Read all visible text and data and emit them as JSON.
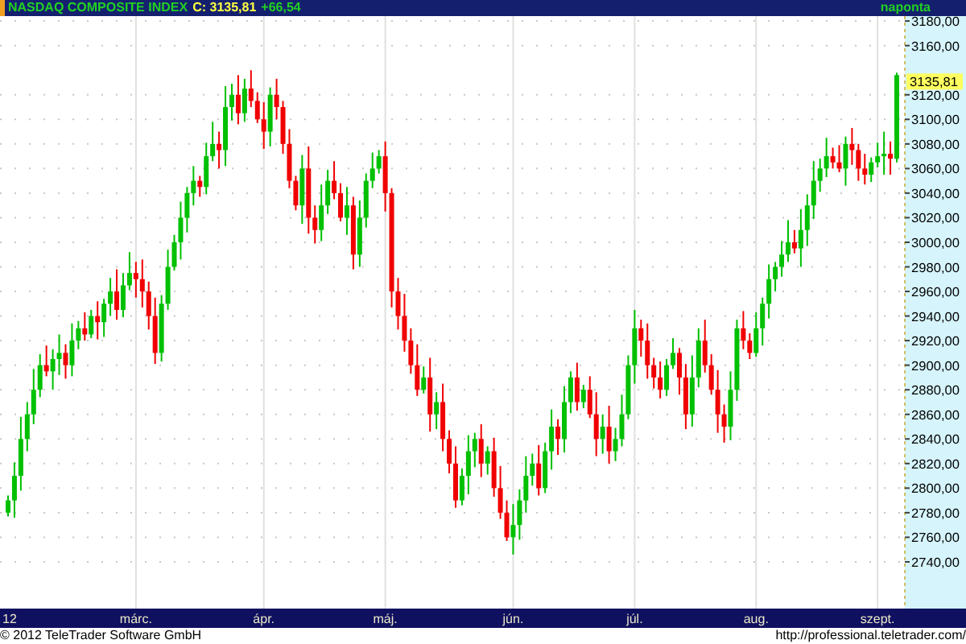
{
  "header": {
    "title": "NASDAQ COMPOSITE INDEX",
    "close": "C: 3135,81",
    "change": "+66,54",
    "interval": "naponta"
  },
  "chart": {
    "price_tag": "3135,81",
    "chart_data": {
      "type": "candlestick",
      "grid": true,
      "ylim": [
        2702,
        3184
      ],
      "categories": [
        "12",
        null,
        null,
        null,
        null,
        null,
        null,
        null,
        null,
        null,
        null,
        null,
        null,
        null,
        null,
        null,
        null,
        null,
        null,
        null,
        "márc.",
        null,
        null,
        null,
        null,
        null,
        null,
        null,
        null,
        null,
        null,
        null,
        null,
        null,
        null,
        null,
        null,
        null,
        null,
        null,
        "ápr.",
        null,
        null,
        null,
        null,
        null,
        null,
        null,
        null,
        null,
        null,
        null,
        null,
        null,
        null,
        null,
        null,
        null,
        null,
        "máj.",
        null,
        null,
        null,
        null,
        null,
        null,
        null,
        null,
        null,
        null,
        null,
        null,
        null,
        null,
        null,
        null,
        null,
        null,
        null,
        "jún.",
        null,
        null,
        null,
        null,
        null,
        null,
        null,
        null,
        null,
        null,
        null,
        null,
        null,
        null,
        null,
        null,
        null,
        null,
        "júl.",
        null,
        null,
        null,
        null,
        null,
        null,
        null,
        null,
        null,
        null,
        null,
        null,
        null,
        null,
        null,
        null,
        null,
        null,
        "aug.",
        null,
        null,
        null,
        null,
        null,
        null,
        null,
        null,
        null,
        null,
        null,
        null,
        null,
        null,
        null,
        null,
        null,
        null,
        "szept.",
        null,
        null,
        null
      ],
      "yticks": [
        {
          "value": 3180,
          "label": "3180,00"
        },
        {
          "value": 3160,
          "label": "3160,00"
        },
        {
          "value": 3120,
          "label": "3120,00"
        },
        {
          "value": 3100,
          "label": "3100,00"
        },
        {
          "value": 3080,
          "label": "3080,00"
        },
        {
          "value": 3060,
          "label": "3060,00"
        },
        {
          "value": 3040,
          "label": "3040,00"
        },
        {
          "value": 3020,
          "label": "3020,00"
        },
        {
          "value": 3000,
          "label": "3000,00"
        },
        {
          "value": 2980,
          "label": "2980,00"
        },
        {
          "value": 2960,
          "label": "2960,00"
        },
        {
          "value": 2940,
          "label": "2940,00"
        },
        {
          "value": 2920,
          "label": "2920,00"
        },
        {
          "value": 2900,
          "label": "2900,00"
        },
        {
          "value": 2880,
          "label": "2880,00"
        },
        {
          "value": 2860,
          "label": "2860,00"
        },
        {
          "value": 2840,
          "label": "2840,00"
        },
        {
          "value": 2820,
          "label": "2820,00"
        },
        {
          "value": 2800,
          "label": "2800,00"
        },
        {
          "value": 2780,
          "label": "2780,00"
        },
        {
          "value": 2760,
          "label": "2760,00"
        },
        {
          "value": 2740,
          "label": "2740,00"
        }
      ],
      "ohlc": [
        [
          2780,
          2794,
          2777,
          2790
        ],
        [
          2790,
          2821,
          2776,
          2810
        ],
        [
          2810,
          2858,
          2798,
          2840
        ],
        [
          2840,
          2870,
          2830,
          2860
        ],
        [
          2860,
          2897,
          2852,
          2880
        ],
        [
          2880,
          2909,
          2874,
          2900
        ],
        [
          2900,
          2916,
          2891,
          2895
        ],
        [
          2895,
          2913,
          2880,
          2905
        ],
        [
          2905,
          2925,
          2892,
          2910
        ],
        [
          2910,
          2917,
          2889,
          2900
        ],
        [
          2900,
          2934,
          2891,
          2920
        ],
        [
          2920,
          2936,
          2913,
          2930
        ],
        [
          2930,
          2943,
          2920,
          2925
        ],
        [
          2925,
          2945,
          2922,
          2940
        ],
        [
          2940,
          2952,
          2921,
          2935
        ],
        [
          2935,
          2954,
          2923,
          2950
        ],
        [
          2950,
          2971,
          2940,
          2960
        ],
        [
          2960,
          2978,
          2937,
          2945
        ],
        [
          2945,
          2975,
          2939,
          2965
        ],
        [
          2965,
          2992,
          2961,
          2975
        ],
        [
          2975,
          2984,
          2955,
          2970
        ],
        [
          2970,
          2986,
          2947,
          2960
        ],
        [
          2960,
          2968,
          2929,
          2940
        ],
        [
          2940,
          2955,
          2901,
          2910
        ],
        [
          2910,
          2957,
          2903,
          2950
        ],
        [
          2950,
          2994,
          2945,
          2980
        ],
        [
          2980,
          3006,
          2977,
          3000
        ],
        [
          3000,
          3033,
          2986,
          3020
        ],
        [
          3020,
          3045,
          3008,
          3040
        ],
        [
          3040,
          3062,
          3030,
          3050
        ],
        [
          3050,
          3054,
          3037,
          3045
        ],
        [
          3045,
          3081,
          3039,
          3070
        ],
        [
          3070,
          3098,
          3066,
          3080
        ],
        [
          3080,
          3090,
          3060,
          3075
        ],
        [
          3075,
          3127,
          3062,
          3110
        ],
        [
          3110,
          3129,
          3099,
          3120
        ],
        [
          3120,
          3136,
          3096,
          3105
        ],
        [
          3105,
          3133,
          3098,
          3125
        ],
        [
          3125,
          3140,
          3110,
          3115
        ],
        [
          3115,
          3122,
          3097,
          3100
        ],
        [
          3100,
          3114,
          3076,
          3090
        ],
        [
          3090,
          3126,
          3078,
          3120
        ],
        [
          3120,
          3133,
          3100,
          3110
        ],
        [
          3110,
          3115,
          3072,
          3080
        ],
        [
          3080,
          3092,
          3044,
          3050
        ],
        [
          3050,
          3054,
          3026,
          3030
        ],
        [
          3030,
          3071,
          3015,
          3060
        ],
        [
          3060,
          3078,
          3007,
          3020
        ],
        [
          3020,
          3030,
          2999,
          3010
        ],
        [
          3010,
          3047,
          3001,
          3030
        ],
        [
          3030,
          3059,
          3023,
          3050
        ],
        [
          3050,
          3066,
          3035,
          3040
        ],
        [
          3040,
          3048,
          3017,
          3020
        ],
        [
          3020,
          3045,
          3006,
          3030
        ],
        [
          3030,
          3037,
          2978,
          2990
        ],
        [
          2990,
          3034,
          2980,
          3020
        ],
        [
          3020,
          3056,
          3012,
          3050
        ],
        [
          3050,
          3073,
          3044,
          3060
        ],
        [
          3060,
          3075,
          3056,
          3070
        ],
        [
          3070,
          3082,
          3025,
          3040
        ],
        [
          3040,
          3044,
          2947,
          2960
        ],
        [
          2960,
          2971,
          2929,
          2940
        ],
        [
          2940,
          2958,
          2911,
          2920
        ],
        [
          2920,
          2930,
          2893,
          2900
        ],
        [
          2900,
          2917,
          2875,
          2880
        ],
        [
          2880,
          2899,
          2877,
          2890
        ],
        [
          2890,
          2906,
          2846,
          2860
        ],
        [
          2860,
          2878,
          2848,
          2870
        ],
        [
          2870,
          2885,
          2830,
          2840
        ],
        [
          2840,
          2847,
          2812,
          2820
        ],
        [
          2820,
          2834,
          2784,
          2790
        ],
        [
          2790,
          2816,
          2786,
          2810
        ],
        [
          2810,
          2843,
          2795,
          2830
        ],
        [
          2830,
          2845,
          2817,
          2840
        ],
        [
          2840,
          2852,
          2809,
          2820
        ],
        [
          2820,
          2834,
          2811,
          2830
        ],
        [
          2830,
          2841,
          2793,
          2800
        ],
        [
          2800,
          2818,
          2775,
          2780
        ],
        [
          2780,
          2790,
          2757,
          2760
        ],
        [
          2760,
          2787,
          2746,
          2770
        ],
        [
          2770,
          2799,
          2758,
          2790
        ],
        [
          2790,
          2826,
          2780,
          2810
        ],
        [
          2810,
          2828,
          2802,
          2820
        ],
        [
          2820,
          2835,
          2794,
          2800
        ],
        [
          2800,
          2837,
          2796,
          2830
        ],
        [
          2830,
          2864,
          2815,
          2850
        ],
        [
          2850,
          2856,
          2827,
          2840
        ],
        [
          2840,
          2883,
          2829,
          2870
        ],
        [
          2870,
          2895,
          2861,
          2890
        ],
        [
          2890,
          2902,
          2863,
          2870
        ],
        [
          2870,
          2884,
          2865,
          2880
        ],
        [
          2880,
          2891,
          2857,
          2860
        ],
        [
          2860,
          2878,
          2826,
          2840
        ],
        [
          2840,
          2860,
          2828,
          2850
        ],
        [
          2850,
          2867,
          2820,
          2830
        ],
        [
          2830,
          2849,
          2822,
          2840
        ],
        [
          2840,
          2876,
          2834,
          2860
        ],
        [
          2860,
          2908,
          2856,
          2900
        ],
        [
          2900,
          2945,
          2885,
          2930
        ],
        [
          2930,
          2937,
          2907,
          2920
        ],
        [
          2920,
          2934,
          2889,
          2900
        ],
        [
          2900,
          2906,
          2881,
          2890
        ],
        [
          2890,
          2903,
          2873,
          2880
        ],
        [
          2880,
          2905,
          2875,
          2900
        ],
        [
          2900,
          2922,
          2897,
          2910
        ],
        [
          2910,
          2914,
          2876,
          2890
        ],
        [
          2890,
          2901,
          2848,
          2860
        ],
        [
          2860,
          2908,
          2850,
          2890
        ],
        [
          2890,
          2930,
          2882,
          2920
        ],
        [
          2920,
          2937,
          2894,
          2900
        ],
        [
          2900,
          2909,
          2876,
          2880
        ],
        [
          2880,
          2896,
          2845,
          2860
        ],
        [
          2860,
          2868,
          2837,
          2850
        ],
        [
          2850,
          2895,
          2839,
          2880
        ],
        [
          2880,
          2937,
          2871,
          2930
        ],
        [
          2930,
          2944,
          2913,
          2920
        ],
        [
          2920,
          2926,
          2905,
          2910
        ],
        [
          2910,
          2943,
          2907,
          2930
        ],
        [
          2930,
          2955,
          2916,
          2950
        ],
        [
          2950,
          2982,
          2938,
          2970
        ],
        [
          2970,
          2984,
          2960,
          2980
        ],
        [
          2980,
          3001,
          2972,
          2990
        ],
        [
          2990,
          3018,
          2984,
          3000
        ],
        [
          3000,
          3010,
          2991,
          2995
        ],
        [
          2995,
          3027,
          2980,
          3010
        ],
        [
          3010,
          3039,
          2997,
          3030
        ],
        [
          3030,
          3066,
          3019,
          3050
        ],
        [
          3050,
          3068,
          3041,
          3060
        ],
        [
          3060,
          3085,
          3053,
          3070
        ],
        [
          3070,
          3077,
          3060,
          3065
        ],
        [
          3065,
          3079,
          3057,
          3060
        ],
        [
          3060,
          3086,
          3046,
          3080
        ],
        [
          3080,
          3093,
          3063,
          3075
        ],
        [
          3075,
          3080,
          3050,
          3060
        ],
        [
          3060,
          3072,
          3047,
          3055
        ],
        [
          3055,
          3069,
          3049,
          3065
        ],
        [
          3065,
          3081,
          3061,
          3070
        ],
        [
          3070,
          3090,
          3055,
          3072
        ],
        [
          3072,
          3082,
          3055,
          3068
        ],
        [
          3068,
          3138,
          3065,
          3136
        ]
      ]
    }
  },
  "footer": {
    "copyright": "© 2012 TeleTrader Software GmbH",
    "url": "http://professional.teletrader.com/"
  }
}
